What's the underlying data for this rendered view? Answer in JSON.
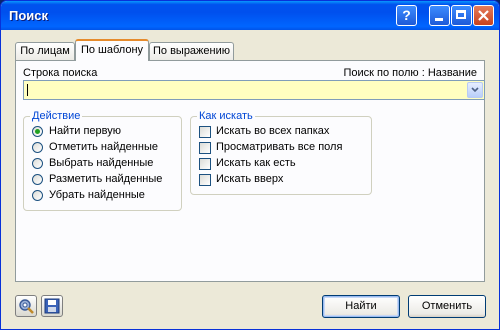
{
  "window": {
    "title": "Поиск"
  },
  "titlebar_buttons": {
    "help": "?"
  },
  "tabs": [
    {
      "label": "По лицам",
      "active": false
    },
    {
      "label": "По шаблону",
      "active": true
    },
    {
      "label": "По выражению",
      "active": false
    }
  ],
  "search": {
    "label": "Строка поиска",
    "field_label": "Поиск по полю : Название",
    "value": ""
  },
  "action_group": {
    "title": "Действие",
    "options": [
      {
        "label": "Найти первую",
        "selected": true
      },
      {
        "label": "Отметить найденные",
        "selected": false
      },
      {
        "label": "Выбрать найденные",
        "selected": false
      },
      {
        "label": "Разметить найденные",
        "selected": false
      },
      {
        "label": "Убрать найденные",
        "selected": false
      }
    ]
  },
  "how_group": {
    "title": "Как искать",
    "options": [
      {
        "label": "Искать во всех папках",
        "checked": false
      },
      {
        "label": "Просматривать все поля",
        "checked": false
      },
      {
        "label": "Искать как есть",
        "checked": false
      },
      {
        "label": "Искать вверх",
        "checked": false
      }
    ]
  },
  "buttons": {
    "find": "Найти",
    "cancel": "Отменить"
  },
  "icons": {
    "tools": "tools-icon",
    "save": "floppy-disk-icon"
  },
  "colors": {
    "titlebar": "#0053ee",
    "combo_bg": "#ffffc0",
    "group_title": "#0046d5",
    "radio_dot": "#21a121"
  }
}
